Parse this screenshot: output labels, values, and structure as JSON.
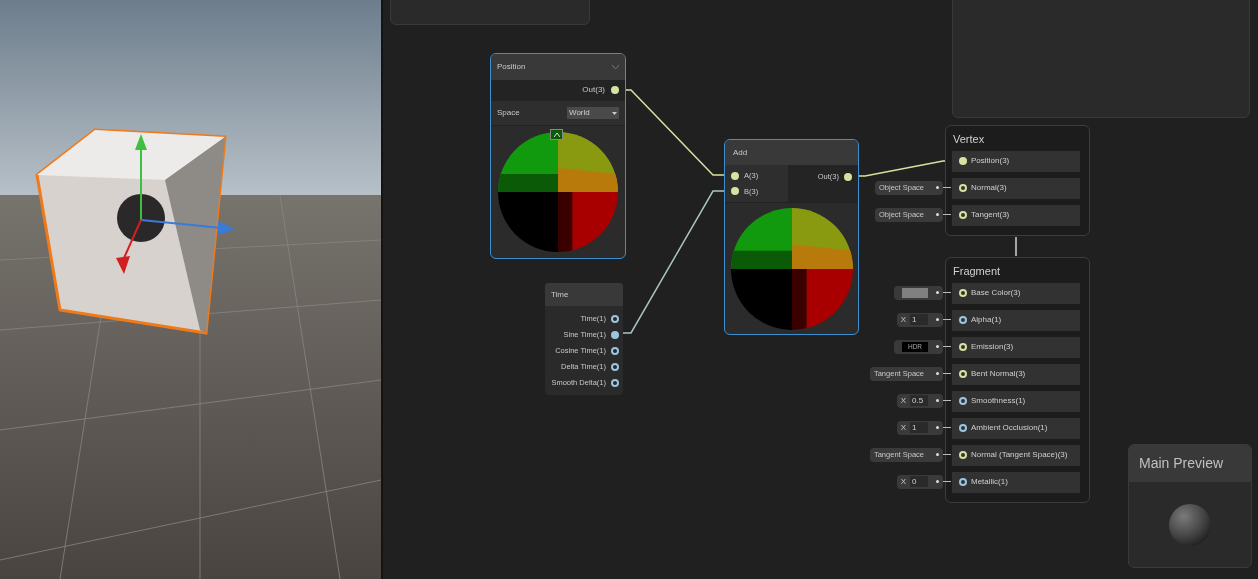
{
  "position_node": {
    "title": "Position",
    "outputs": [
      {
        "label": "Out(3)",
        "color": "#d3e3a0",
        "connected": true
      }
    ],
    "space": {
      "label": "Space",
      "value": "World"
    }
  },
  "time_node": {
    "title": "Time",
    "outputs": [
      {
        "label": "Time(1)",
        "color": "#9cc6e0",
        "connected": false
      },
      {
        "label": "Sine Time(1)",
        "color": "#9cc6e0",
        "connected": true
      },
      {
        "label": "Cosine Time(1)",
        "color": "#9cc6e0",
        "connected": false
      },
      {
        "label": "Delta Time(1)",
        "color": "#9cc6e0",
        "connected": false
      },
      {
        "label": "Smooth Delta(1)",
        "color": "#9cc6e0",
        "connected": false
      }
    ]
  },
  "add_node": {
    "title": "Add",
    "inputs": [
      {
        "label": "A(3)",
        "color": "#d3e3a0",
        "connected": true
      },
      {
        "label": "B(3)",
        "color": "#d3e3a0",
        "connected": true
      }
    ],
    "outputs": [
      {
        "label": "Out(3)",
        "color": "#d3e3a0",
        "connected": true
      }
    ]
  },
  "vertex": {
    "title": "Vertex",
    "ports": [
      {
        "label": "Position(3)",
        "color": "#d3e3a0",
        "connected": true
      },
      {
        "label": "Normal(3)",
        "color": "#d3e3a0",
        "connected": false,
        "control": {
          "kind": "space",
          "value": "Object Space"
        }
      },
      {
        "label": "Tangent(3)",
        "color": "#d3e3a0",
        "connected": false,
        "control": {
          "kind": "space",
          "value": "Object Space"
        }
      }
    ]
  },
  "fragment": {
    "title": "Fragment",
    "ports": [
      {
        "label": "Base Color(3)",
        "color": "#d3e3a0",
        "connected": false,
        "control": {
          "kind": "color",
          "color": "#808080"
        }
      },
      {
        "label": "Alpha(1)",
        "color": "#9cc6e0",
        "connected": false,
        "control": {
          "kind": "number",
          "axis": "X",
          "value": "1"
        }
      },
      {
        "label": "Emission(3)",
        "color": "#d3e3a0",
        "connected": false,
        "control": {
          "kind": "hdr",
          "value": "HDR"
        }
      },
      {
        "label": "Bent Normal(3)",
        "color": "#d3e3a0",
        "connected": false,
        "control": {
          "kind": "space",
          "value": "Tangent Space"
        }
      },
      {
        "label": "Smoothness(1)",
        "color": "#9cc6e0",
        "connected": false,
        "control": {
          "kind": "number",
          "axis": "X",
          "value": "0.5"
        }
      },
      {
        "label": "Ambient Occlusion(1)",
        "color": "#9cc6e0",
        "connected": false,
        "control": {
          "kind": "number",
          "axis": "X",
          "value": "1"
        }
      },
      {
        "label": "Normal (Tangent Space)(3)",
        "color": "#d3e3a0",
        "connected": false,
        "control": {
          "kind": "space",
          "value": "Tangent Space"
        }
      },
      {
        "label": "Metallic(1)",
        "color": "#9cc6e0",
        "connected": false,
        "control": {
          "kind": "number",
          "axis": "X",
          "value": "0"
        }
      }
    ]
  },
  "main_preview": {
    "title": "Main Preview"
  }
}
